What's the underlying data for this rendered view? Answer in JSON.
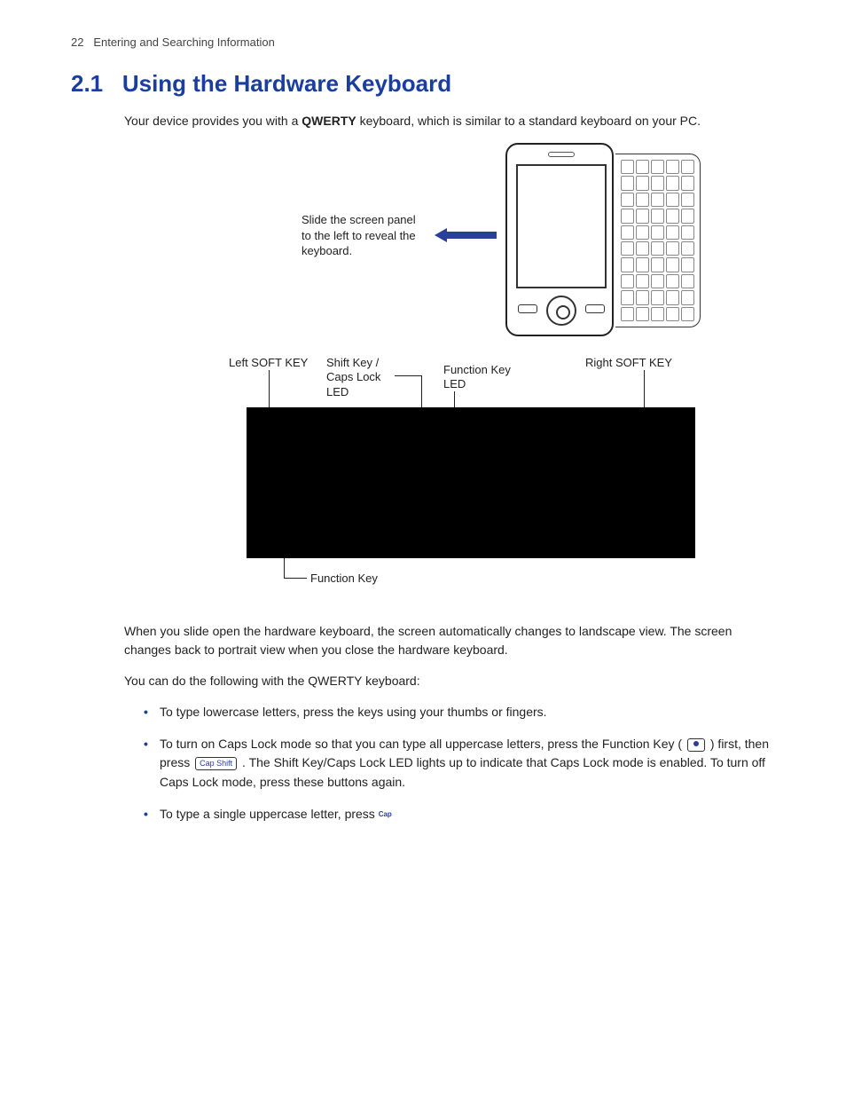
{
  "header": {
    "page_number": "22",
    "chapter": "Entering and Searching Information"
  },
  "section": {
    "number": "2.1",
    "title": "Using the Hardware Keyboard"
  },
  "intro": {
    "prefix": "Your device provides you with a ",
    "bold": "QWERTY",
    "suffix": " keyboard, which is similar to a standard keyboard on your PC."
  },
  "fig1": {
    "callout": "Slide the screen panel to the left to reveal the keyboard."
  },
  "fig2": {
    "labels": {
      "left_soft": "Left SOFT KEY",
      "shift_caps": "Shift Key / Caps Lock LED",
      "func_led": "Function Key LED",
      "right_soft": "Right SOFT KEY",
      "func_key": "Function Key"
    }
  },
  "para2": "When you slide open the hardware keyboard, the screen automatically changes to landscape view. The screen changes back to portrait view when you close the hardware keyboard.",
  "para3": "You can do the following with the QWERTY keyboard:",
  "bullets": {
    "b1": "To type lowercase letters, press the keys using your thumbs or fingers.",
    "b2_a": "To turn on Caps Lock mode so that you can type all uppercase letters, press the Function Key (",
    "b2_b": ") first, then press ",
    "b2_keycap": "Cap Shift",
    "b2_c": ". The Shift Key/Caps Lock LED lights up to indicate that Caps Lock mode is enabled. To turn off Caps Lock mode, press these buttons again.",
    "b3_a": "To type a single uppercase letter, press ",
    "b3_key": "Cap"
  }
}
